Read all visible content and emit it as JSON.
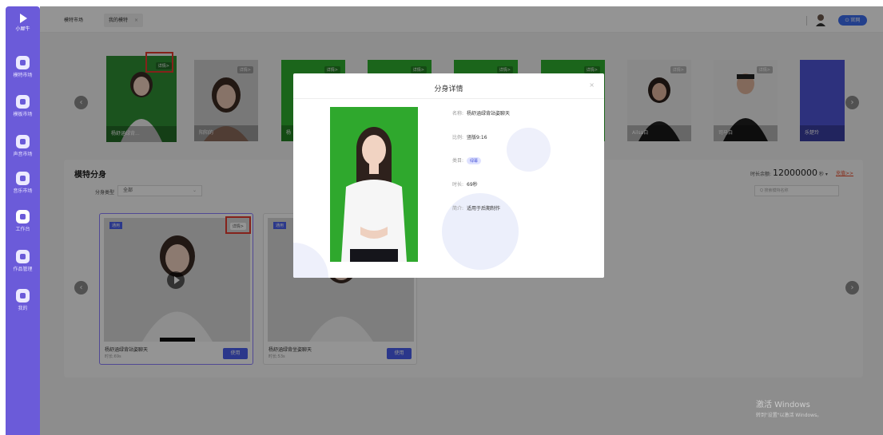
{
  "app": {
    "logo_text": "小犀牛"
  },
  "sidebar": {
    "items": [
      {
        "label": "模特市场",
        "icon": "model-market-icon"
      },
      {
        "label": "模板市场",
        "icon": "template-market-icon"
      },
      {
        "label": "声音市场",
        "icon": "voice-market-icon"
      },
      {
        "label": "音乐市场",
        "icon": "music-market-icon"
      },
      {
        "label": "工作台",
        "icon": "workbench-icon"
      },
      {
        "label": "作品管理",
        "icon": "works-icon"
      },
      {
        "label": "我的",
        "icon": "profile-icon"
      }
    ]
  },
  "topbar": {
    "tabs": [
      {
        "label": "模特市场"
      },
      {
        "label": "我的模特"
      }
    ],
    "close_symbol": "×",
    "website_label": "官网"
  },
  "gallery": {
    "detail_label": "详情>",
    "prev_symbol": "‹",
    "next_symbol": "›",
    "cards": [
      {
        "caption": "杨舒涵绿背..."
      },
      {
        "caption": "阳阳的"
      },
      {
        "caption": "杨"
      },
      {
        "caption": ""
      },
      {
        "caption": ""
      },
      {
        "caption": ""
      },
      {
        "caption": "Ailsa白"
      },
      {
        "caption": "司马白"
      },
      {
        "caption": "乐楚玲"
      }
    ]
  },
  "panel": {
    "title": "模特分身",
    "filter_label": "分身类型",
    "filter_value": "全部",
    "duration_label": "时长余额:",
    "duration_value": "12000000",
    "duration_unit": "秒",
    "recharge_label": "充值>>",
    "search_placeholder": "Q 搜索模特名称",
    "cards": [
      {
        "tag": "通用",
        "detail": "详情>",
        "name": "杨舒涵绿背站姿聊天",
        "sub": "时长:69s",
        "use": "使用"
      },
      {
        "tag": "通用",
        "detail": "",
        "name": "杨舒涵绿背坐姿聊天",
        "sub": "时长:53s",
        "use": "使用"
      }
    ]
  },
  "modal": {
    "title": "分身详情",
    "close_symbol": "×",
    "fields": {
      "name_label": "名称:",
      "name_value": "杨舒涵绿背站姿聊天",
      "ratio_label": "比例:",
      "ratio_value": "竖版9:16",
      "category_label": "类目:",
      "category_value": "绿幕",
      "duration_label": "时长:",
      "duration_value": "69秒",
      "intro_label": "简介:",
      "intro_value": "适用于后期制作"
    }
  },
  "watermark": {
    "line1": "激活 Windows",
    "line2": "转到\"设置\"以激活 Windows。"
  },
  "colors": {
    "sidebar": "#6b5bd9",
    "accent": "#4b5ff0",
    "highlight": "#e53b2f",
    "green_screen": "#2fa82d"
  }
}
